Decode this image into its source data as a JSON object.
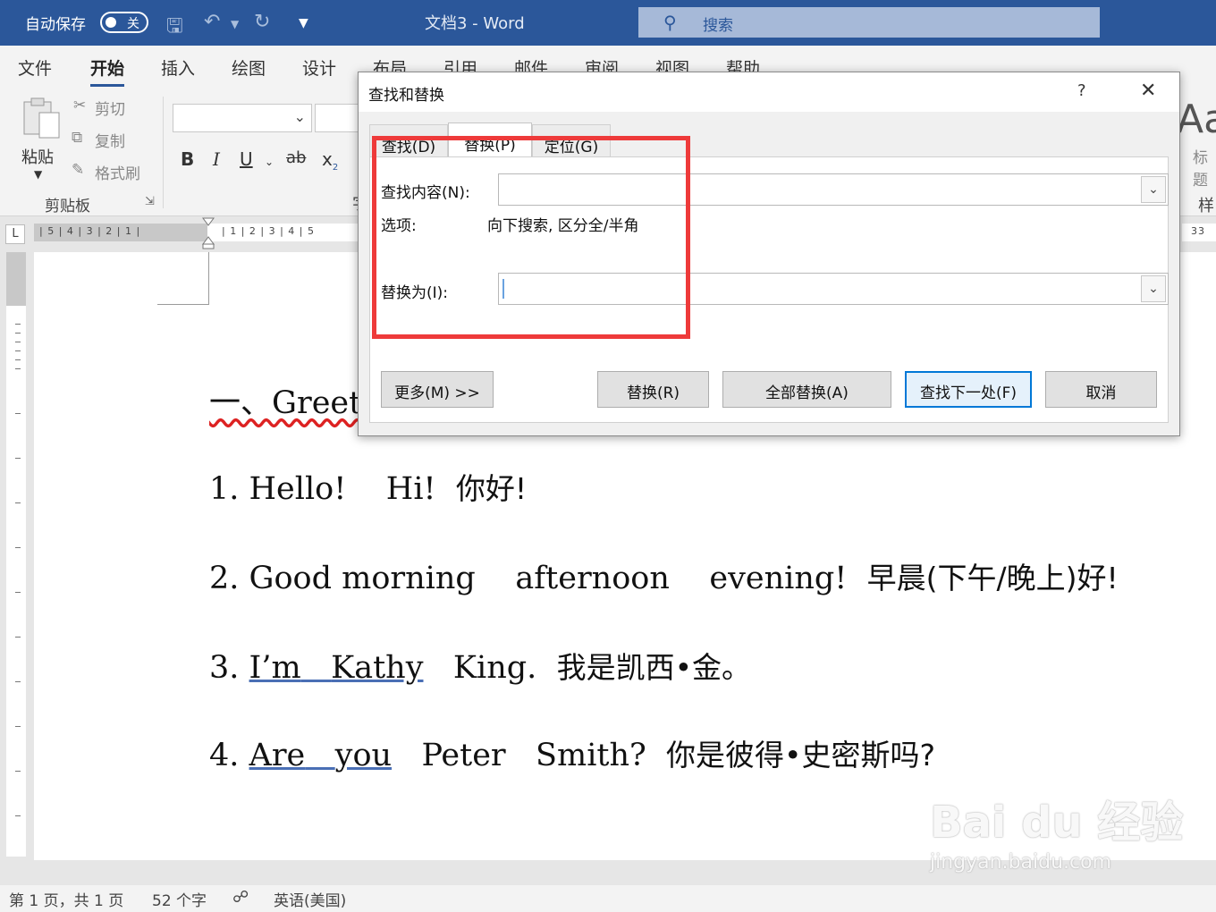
{
  "titlebar": {
    "autosave_label": "自动保存",
    "autosave_state": "关",
    "document_title": "文档3  -  Word",
    "search_placeholder": "搜索"
  },
  "menu": [
    "文件",
    "开始",
    "插入",
    "绘图",
    "设计",
    "布局",
    "引用",
    "邮件",
    "审阅",
    "视图",
    "帮助"
  ],
  "ribbon": {
    "paste": "粘贴",
    "cut": "剪切",
    "copy": "复制",
    "format_painter": "格式刷",
    "clipboard_group": "剪贴板",
    "font_group_partial": "字",
    "styles_partial": "Aa",
    "styles_label_partial": "标题",
    "styles_group_partial": "样"
  },
  "ruler": {
    "left_numbers": "|  5  |  4  |  3  |  2  |  1  |",
    "right_numbers": "|  1  |  2  |  3  |  4  |  5",
    "far_right": "33"
  },
  "document": {
    "line0": "一、Greeting",
    "line1_a": "1. Hello!",
    "line1_b": "Hi!",
    "line1_c": "你好!",
    "line2_a": "2. Good morning",
    "line2_b": "afternoon",
    "line2_c": "evening!",
    "line2_d": "早晨(下午/晚上)好!",
    "line3_a": "3.",
    "line3_b": "I’m",
    "line3_c": "Kathy",
    "line3_d": "King.",
    "line3_e": "我是凯西•金。",
    "line4_a": "4.",
    "line4_b": "Are",
    "line4_c": "you",
    "line4_d": "Peter",
    "line4_e": "Smith?",
    "line4_f": "你是彼得•史密斯吗?"
  },
  "statusbar": {
    "page": "第 1 页，共 1 页",
    "words": "52 个字",
    "language": "英语(美国)"
  },
  "dialog": {
    "title": "查找和替换",
    "help": "?",
    "close": "✕",
    "tabs": [
      "查找(D)",
      "替换(P)",
      "定位(G)"
    ],
    "active_tab": "替换(P)",
    "find_label": "查找内容(N):",
    "find_value": "",
    "options_label": "选项:",
    "options_value": "向下搜索, 区分全/半角",
    "replace_label": "替换为(I):",
    "replace_value": "",
    "buttons": {
      "more": "更多(M) >>",
      "replace": "替换(R)",
      "replace_all": "全部替换(A)",
      "find_next": "查找下一处(F)",
      "cancel": "取消"
    }
  },
  "watermark": {
    "brand": "Bai du 经验",
    "url": "jingyan.baidu.com"
  },
  "colors": {
    "title_bar": "#2b579a",
    "highlight_box": "#ee3a3a",
    "default_button_border": "#0078d7"
  }
}
